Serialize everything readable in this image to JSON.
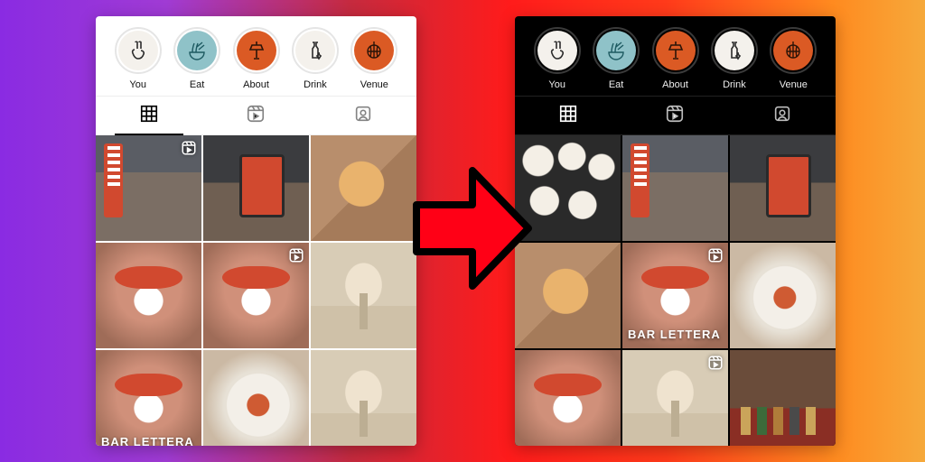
{
  "highlights": [
    {
      "label": "You",
      "bg": "#f4f1ec",
      "fg": "#2b2b2b",
      "icon": "peace"
    },
    {
      "label": "Eat",
      "bg": "#8fc2c8",
      "fg": "#1d5a61",
      "icon": "noodles"
    },
    {
      "label": "About",
      "bg": "#db5a24",
      "fg": "#2b1408",
      "icon": "lamp"
    },
    {
      "label": "Drink",
      "bg": "#f4f1ec",
      "fg": "#2b2b2b",
      "icon": "bottle"
    },
    {
      "label": "Venue",
      "bg": "#db5a24",
      "fg": "#2b1408",
      "icon": "disco"
    }
  ],
  "tabs": [
    "grid",
    "reels",
    "tagged"
  ],
  "active_tab": "grid",
  "caption_text": "BAR LETTERA",
  "grids": {
    "left": [
      {
        "art": "c-store",
        "reel": true
      },
      {
        "art": "c-kiosk"
      },
      {
        "art": "c-eat"
      },
      {
        "art": "c-smile"
      },
      {
        "art": "c-smile",
        "reel": true
      },
      {
        "art": "c-cocktail"
      },
      {
        "art": "c-smile",
        "caption": true
      },
      {
        "art": "c-plate"
      },
      {
        "art": "c-cocktail"
      }
    ],
    "right": [
      {
        "art": "c-plates"
      },
      {
        "art": "c-store"
      },
      {
        "art": "c-kiosk"
      },
      {
        "art": "c-eat"
      },
      {
        "art": "c-smile",
        "caption": true,
        "reel": true
      },
      {
        "art": "c-plate"
      },
      {
        "art": "c-smile"
      },
      {
        "art": "c-cocktail",
        "reel": true
      },
      {
        "art": "c-bar"
      }
    ]
  }
}
